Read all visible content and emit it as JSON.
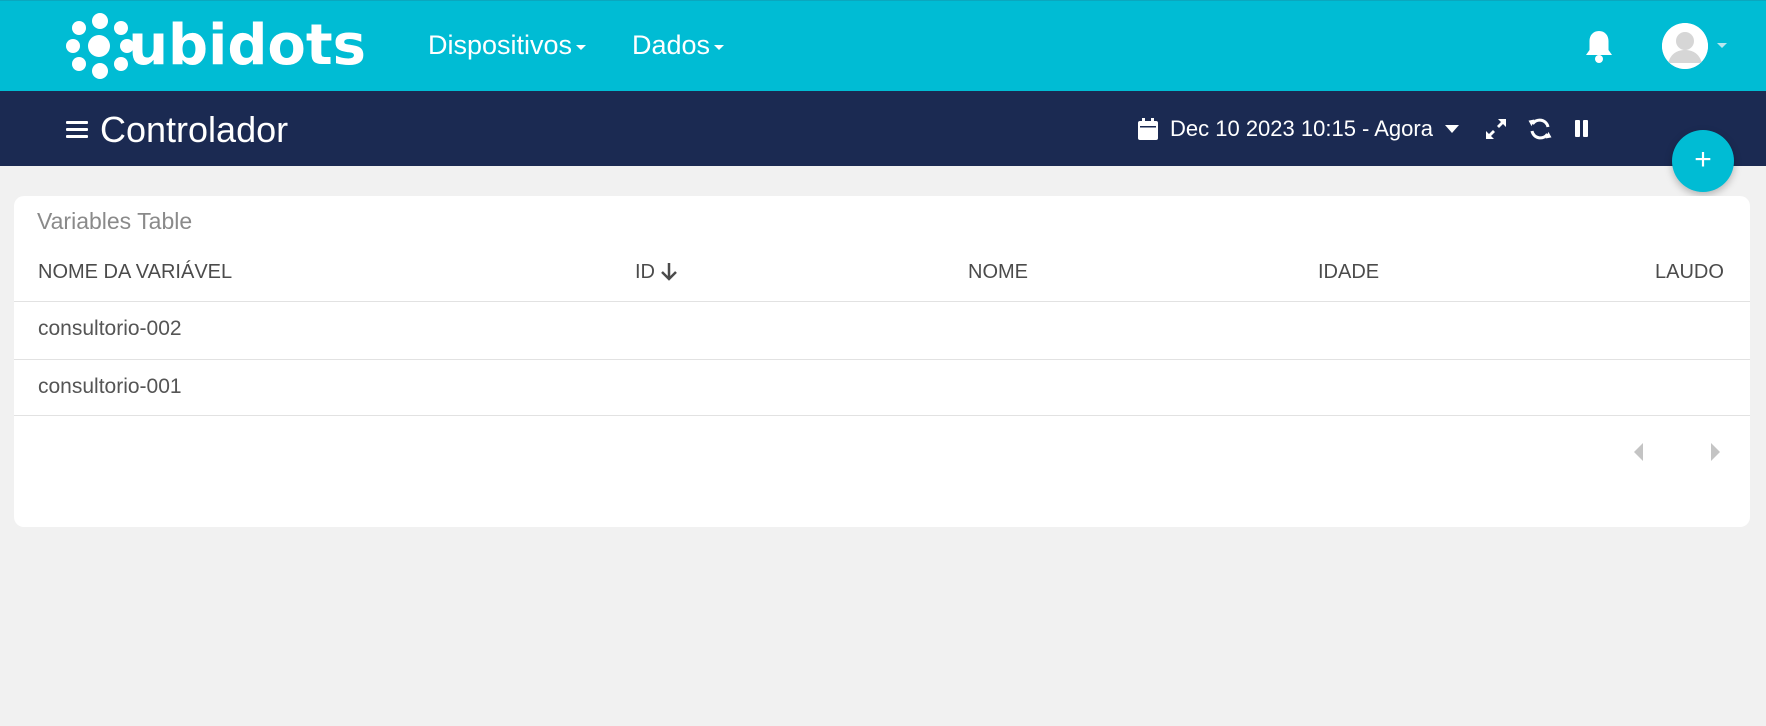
{
  "app": {
    "logo_text": "ubidots"
  },
  "nav": {
    "items": [
      {
        "label": "Dispositivos"
      },
      {
        "label": "Dados"
      }
    ]
  },
  "dashboard": {
    "title": "Controlador",
    "date_range": "Dec 10 2023 10:15 - Agora",
    "add_button": "+"
  },
  "table": {
    "title": "Variables Table",
    "columns": [
      "NOME DA VARIÁVEL",
      "ID",
      "NOME",
      "IDADE",
      "LAUDO"
    ],
    "sort_column": "ID",
    "sort_direction": "desc",
    "rows": [
      {
        "name": "consultorio-002",
        "id": "",
        "nome": "",
        "idade": "",
        "laudo": ""
      },
      {
        "name": "consultorio-001",
        "id": "",
        "nome": "",
        "idade": "",
        "laudo": ""
      }
    ]
  },
  "colors": {
    "primary": "#00bcd4",
    "header_dark": "#1b2a52",
    "background": "#f1f1f1"
  }
}
